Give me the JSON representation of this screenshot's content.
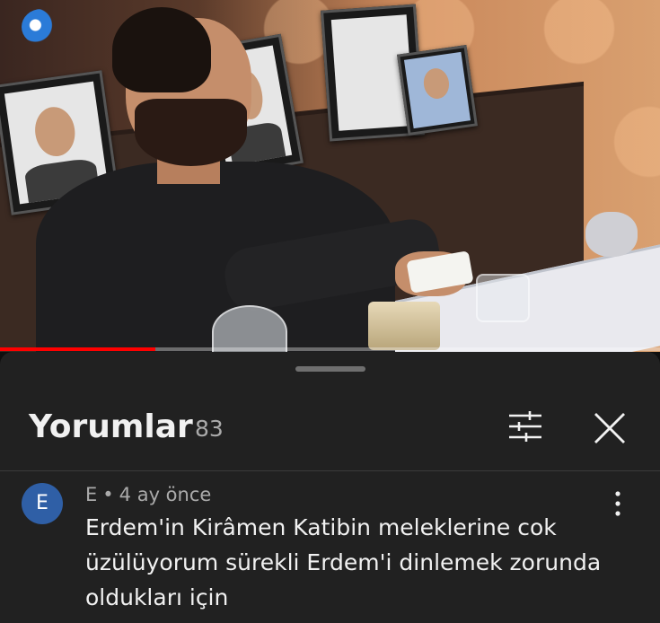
{
  "video": {
    "progress_fraction": 0.235
  },
  "comments_panel": {
    "title": "Yorumlar",
    "count": "83",
    "filter_icon": "tune-sliders-icon",
    "close_icon": "close-x-icon",
    "comment": {
      "avatar_letter": "E",
      "avatar_color": "#2f5fa6",
      "author": "E",
      "separator": "•",
      "time": "4 ay önce",
      "text": "Erdem'in Kirâmen Katibin meleklerine cok üzülüyorum sürekli Erdem'i dinlemek zorunda oldukları için"
    }
  },
  "colors": {
    "panel_bg": "#212121",
    "progress_red": "#ff0000",
    "secondary_text": "#aaaaaa"
  }
}
